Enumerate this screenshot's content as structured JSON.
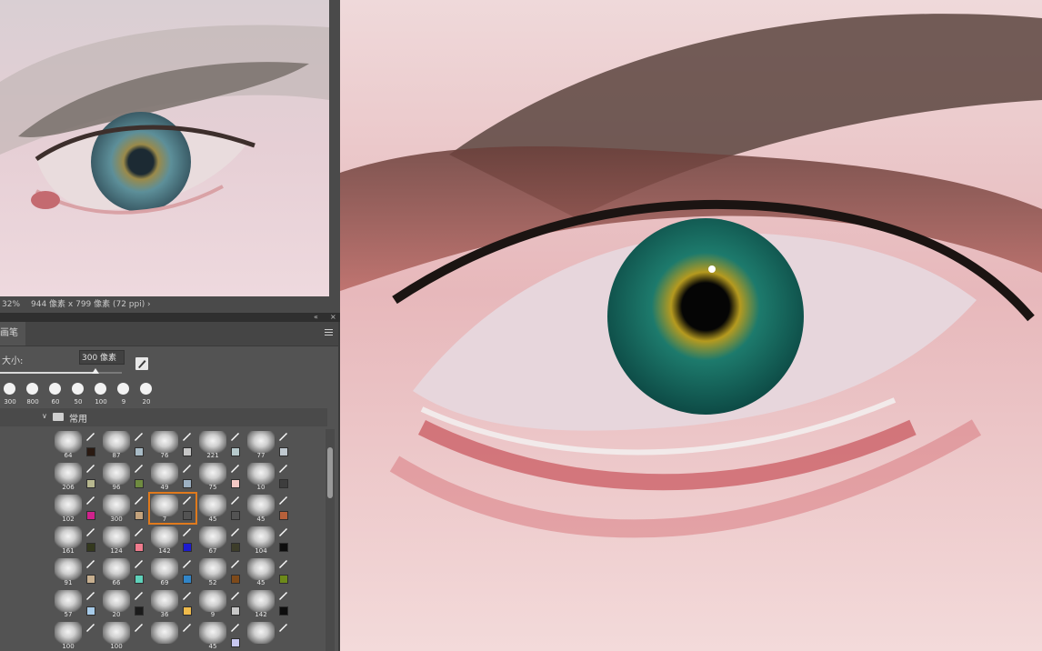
{
  "status": {
    "zoom": "32%",
    "dimensions": "944 像素 x 799 像素 (72 ppi)",
    "arrow": "›"
  },
  "panel": {
    "tab_label": "画笔",
    "size_label": "大小:",
    "size_value": "300 像素",
    "size_slider_fraction": 0.78,
    "folder_name": "常用",
    "presets": [
      "300",
      "800",
      "60",
      "50",
      "100",
      "9",
      "20"
    ],
    "brush_grid": [
      [
        {
          "n": "64",
          "c": "#2a1a12"
        },
        {
          "n": "87",
          "c": "#a9bcc7"
        },
        {
          "n": "76",
          "c": "#c6c6c6"
        },
        {
          "n": "221",
          "c": "#b6c9cc"
        },
        {
          "n": "77",
          "c": "#bfc8cf"
        }
      ],
      [
        {
          "n": "206",
          "c": "#b7b78f"
        },
        {
          "n": "96",
          "c": "#6f8b40"
        },
        {
          "n": "49",
          "c": "#9cb0c2"
        },
        {
          "n": "75",
          "c": "#f3c8c4"
        },
        {
          "n": "10",
          "c": "#3d3d3d"
        }
      ],
      [
        {
          "n": "102",
          "c": "#d0228c"
        },
        {
          "n": "300",
          "c": "#c4a37c"
        },
        {
          "n": "7",
          "c": "#535353"
        },
        {
          "n": "45",
          "c": "#535353"
        },
        {
          "n": "45",
          "c": "#b6603a"
        }
      ],
      [
        {
          "n": "161",
          "c": "#34391e"
        },
        {
          "n": "124",
          "c": "#f07b8d"
        },
        {
          "n": "142",
          "c": "#1d1bd0"
        },
        {
          "n": "67",
          "c": "#3d3d2a"
        },
        {
          "n": "104",
          "c": "#0e0e0e"
        }
      ],
      [
        {
          "n": "91",
          "c": "#c8b090"
        },
        {
          "n": "66",
          "c": "#5fd2bb"
        },
        {
          "n": "69",
          "c": "#3185c8"
        },
        {
          "n": "52",
          "c": "#7e4a1a"
        },
        {
          "n": "45",
          "c": "#6d8a19"
        }
      ],
      [
        {
          "n": "57",
          "c": "#a7cbe9"
        },
        {
          "n": "20",
          "c": "#1b1b1b"
        },
        {
          "n": "36",
          "c": "#f0bb4b"
        },
        {
          "n": "9",
          "c": "#c8c8c8"
        },
        {
          "n": "142",
          "c": "#0d0d0d"
        }
      ],
      [
        {
          "n": "100",
          "c": ""
        },
        {
          "n": "100",
          "c": ""
        },
        {
          "n": "",
          "c": ""
        },
        {
          "n": "45",
          "c": "#c8c8f0"
        },
        {
          "n": "",
          "c": ""
        }
      ]
    ],
    "selected_brush": "7"
  }
}
